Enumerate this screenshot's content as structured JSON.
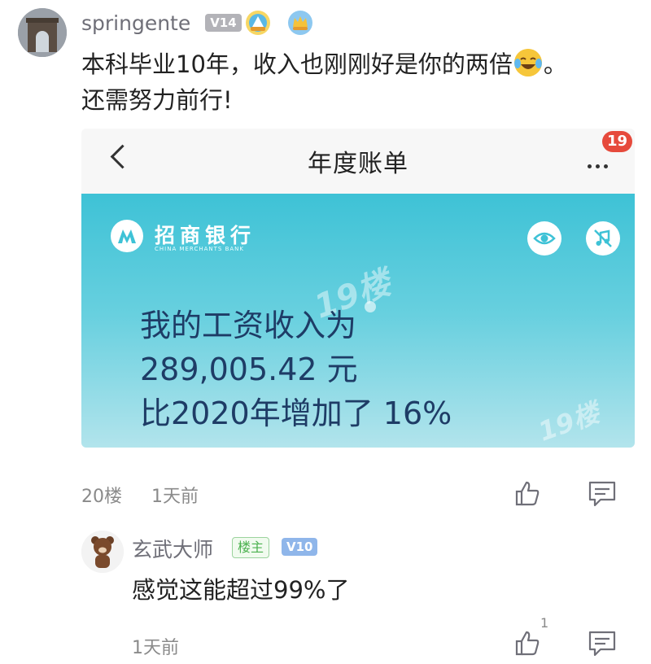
{
  "comment": {
    "username": "springente",
    "level_badge": "V14",
    "text_line1": "本科毕业10年，收入也刚刚好是你的两倍",
    "text_line1_tail": "。",
    "text_line2": "还需努力前行!",
    "floor": "20楼",
    "time": "1天前"
  },
  "bill_screen": {
    "title": "年度账单",
    "notification_count": "19",
    "bank_name": "招商银行",
    "bank_name_en": "CHINA MERCHANTS BANK",
    "line1": "我的工资收入为",
    "line2": "289,005.42 元",
    "line3": "比2020年增加了 16%",
    "watermark": "19楼"
  },
  "reply": {
    "username": "玄武大师",
    "owner_tag": "楼主",
    "level_badge": "V10",
    "text": "感觉这能超过99%了",
    "time": "1天前",
    "like_count": "1"
  },
  "colors": {
    "banner_top": "#3ec2d6",
    "amount_text": "#1e3c66",
    "notif_red": "#e64a3c",
    "owner_green": "#4bb14f",
    "level_blue": "#8fb6ea"
  }
}
